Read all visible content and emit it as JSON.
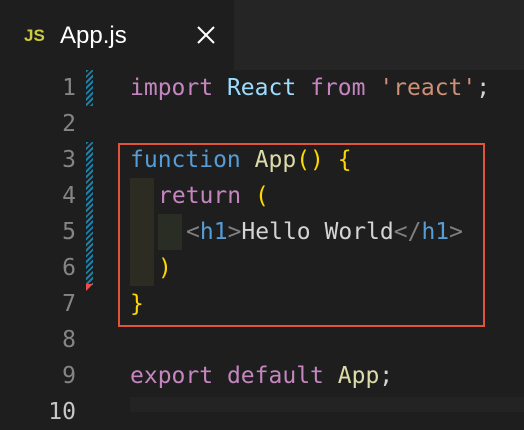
{
  "tab": {
    "lang_badge": "JS",
    "filename": "App.js",
    "close_glyph": "✕"
  },
  "editor": {
    "line_numbers": [
      "1",
      "2",
      "3",
      "4",
      "5",
      "6",
      "7",
      "8",
      "9",
      "10"
    ],
    "code": {
      "l1": {
        "import": "import",
        "react_id": "React",
        "from": "from",
        "module": "'react'",
        "semi": ";"
      },
      "l3": {
        "function": "function",
        "name": "App",
        "parens": "()",
        "brace": "{"
      },
      "l4": {
        "return": "return",
        "paren": "("
      },
      "l5": {
        "lt1": "<",
        "tag_open": "h1",
        "gt1": ">",
        "text": "Hello World",
        "lt2": "</",
        "tag_close": "h1",
        "gt2": ">"
      },
      "l6": {
        "paren": ")"
      },
      "l7": {
        "brace": "}"
      },
      "l9": {
        "export": "export",
        "default": "default",
        "name": "App",
        "semi": ";"
      }
    }
  }
}
